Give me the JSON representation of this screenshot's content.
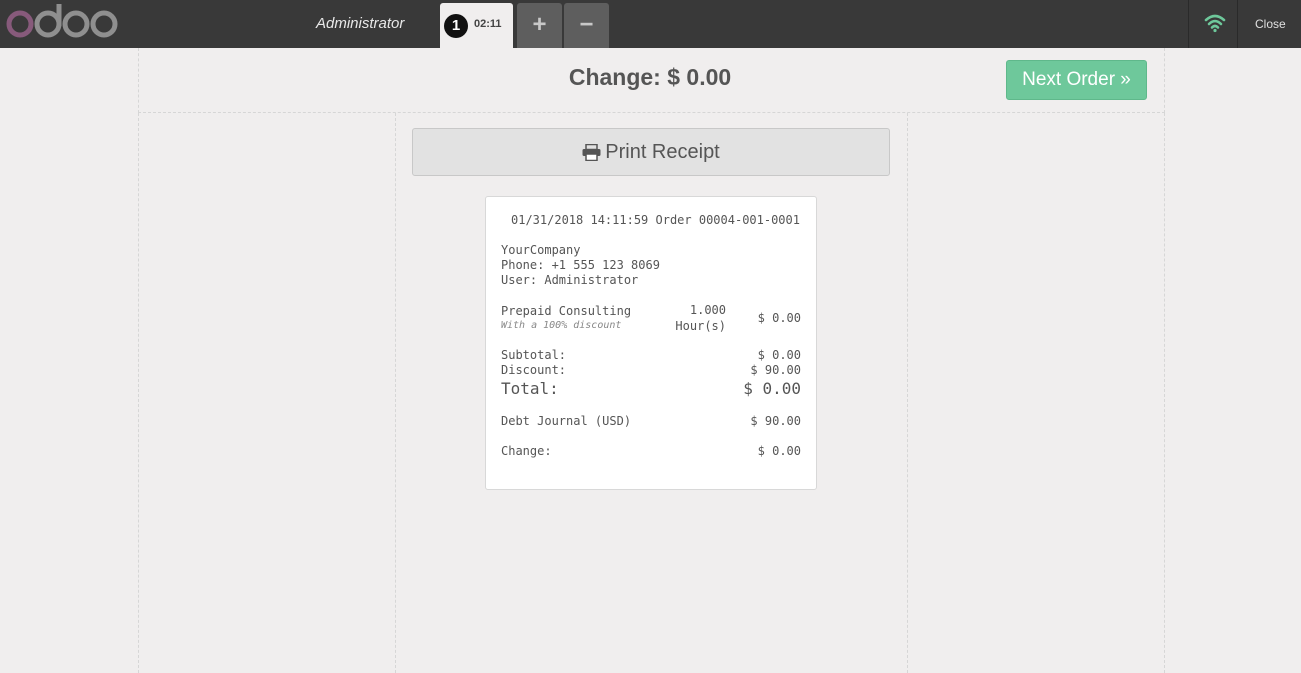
{
  "header": {
    "cashier": "Administrator",
    "order_tab": {
      "sequence": "1",
      "time": "02:11"
    },
    "add_label": "+",
    "remove_label": "−",
    "close_label": "Close",
    "colors": {
      "bar": "#393939",
      "wifi": "#6ec89b",
      "logo_o": "#875a7b",
      "logo_doo": "#8f8f8f"
    }
  },
  "screen": {
    "change_title": "Change: $ 0.00",
    "next_order_label": "Next Order »",
    "print_label": "Print Receipt",
    "colors": {
      "next_order": "#6ec89b"
    }
  },
  "receipt": {
    "header_line": "01/31/2018 14:11:59 Order 00004-001-0001",
    "company": "YourCompany",
    "phone": "Phone: +1 555 123 8069",
    "user": "User: Administrator",
    "lines": [
      {
        "product": "Prepaid Consulting",
        "note": "With a 100% discount",
        "qty": "1.000",
        "uom": "Hour(s)",
        "price": "$ 0.00"
      }
    ],
    "subtotal_label": "Subtotal:",
    "subtotal_value": "$ 0.00",
    "discount_label": "Discount:",
    "discount_value": "$ 90.00",
    "total_label": "Total:",
    "total_value": "$ 0.00",
    "payment_label": "Debt Journal (USD)",
    "payment_value": "$ 90.00",
    "change_label": "Change:",
    "change_value": "$ 0.00"
  }
}
